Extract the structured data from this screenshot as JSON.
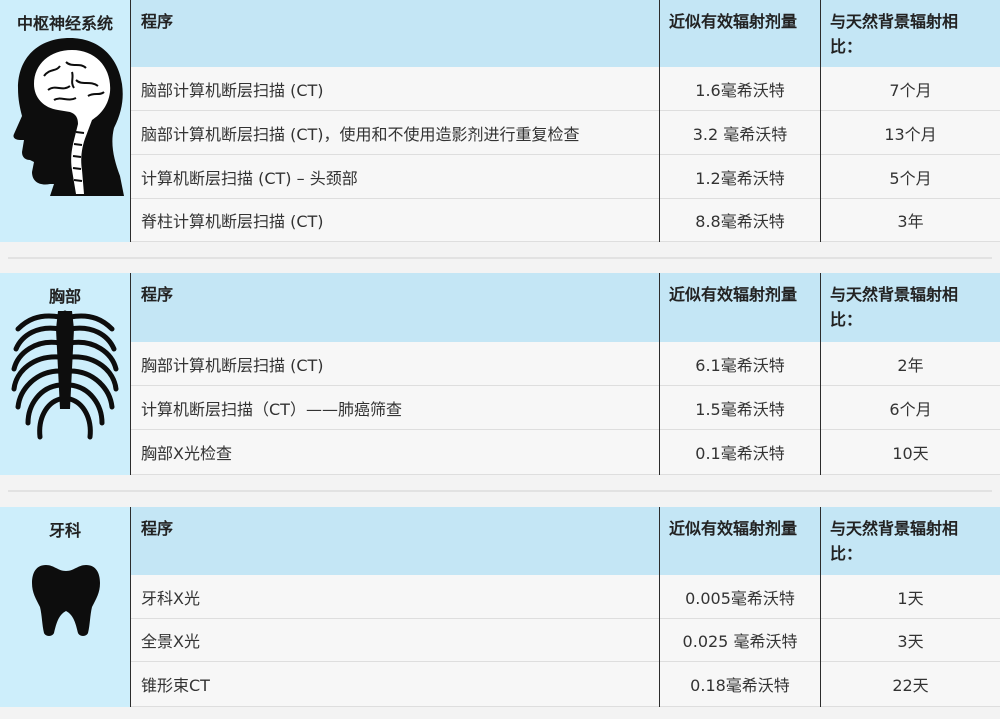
{
  "sections": [
    {
      "id": "cns",
      "title": "中枢神经系统",
      "icon": "head-brain-icon",
      "headers": [
        "程序",
        "近似有效辐射剂量",
        "与天然背景辐射相比："
      ],
      "rows": [
        {
          "procedure": "脑部计算机断层扫描 (CT)",
          "dose": "1.6毫希沃特",
          "comparison": "7个月"
        },
        {
          "procedure": "脑部计算机断层扫描 (CT)，使用和不使用造影剂进行重复检查",
          "dose": "3.2 毫希沃特",
          "comparison": "13个月"
        },
        {
          "procedure": "计算机断层扫描 (CT) – 头颈部",
          "dose": "1.2毫希沃特",
          "comparison": "5个月"
        },
        {
          "procedure": "脊柱计算机断层扫描 (CT)",
          "dose": "8.8毫希沃特",
          "comparison": "3年"
        }
      ]
    },
    {
      "id": "chest",
      "title": "胸部",
      "icon": "ribcage-icon",
      "headers": [
        "程序",
        "近似有效辐射剂量",
        "与天然背景辐射相比："
      ],
      "rows": [
        {
          "procedure": "胸部计算机断层扫描 (CT)",
          "dose": "6.1毫希沃特",
          "comparison": "2年"
        },
        {
          "procedure": "计算机断层扫描（CT）——肺癌筛查",
          "dose": "1.5毫希沃特",
          "comparison": "6个月"
        },
        {
          "procedure": "胸部X光检查",
          "dose": "0.1毫希沃特",
          "comparison": "10天"
        }
      ]
    },
    {
      "id": "dental",
      "title": "牙科",
      "icon": "tooth-icon",
      "headers": [
        "程序",
        "近似有效辐射剂量",
        "与天然背景辐射相比："
      ],
      "rows": [
        {
          "procedure": "牙科X光",
          "dose": "0.005毫希沃特",
          "comparison": "1天"
        },
        {
          "procedure": "全景X光",
          "dose": "0.025 毫希沃特",
          "comparison": "3天"
        },
        {
          "procedure": "锥形束CT",
          "dose": "0.18毫希沃特",
          "comparison": "22天"
        }
      ]
    }
  ]
}
